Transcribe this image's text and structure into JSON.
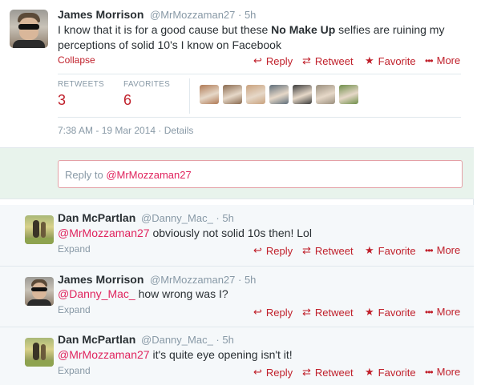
{
  "main_tweet": {
    "name": "James Morrison",
    "handle": "@MrMozzaman27 · 5h",
    "text_before": "I know that it is for a good cause but these ",
    "text_bold": "No Make Up",
    "text_after": " selfies are ruining my perceptions of solid 10's I know on Facebook",
    "collapse_label": "Collapse",
    "actions": {
      "reply": "Reply",
      "retweet": "Retweet",
      "favorite": "Favorite",
      "more": "More"
    },
    "stats": {
      "retweets_label": "RETWEETS",
      "retweets_value": "3",
      "favorites_label": "FAVORITES",
      "favorites_value": "6"
    },
    "favoriter_avatar_colors": [
      "#b07a55",
      "#8a6a4f",
      "#c9a27e",
      "#5f6e7a",
      "#3c3c3c",
      "#9a8f7e",
      "#6f8f4a"
    ],
    "timestamp": "7:38 AM - 19 Mar 2014 · Details"
  },
  "reply_box": {
    "prefix": "Reply to ",
    "mention": "@MrMozzaman27"
  },
  "replies": [
    {
      "name": "Dan McPartlan",
      "handle": "@Danny_Mac_ · 5h",
      "mention": "@MrMozzaman27",
      "text": " obviously not solid 10s then! Lol",
      "expand_label": "Expand",
      "actions": {
        "reply": "Reply",
        "retweet": "Retweet",
        "favorite": "Favorite",
        "more": "More"
      }
    },
    {
      "name": "James Morrison",
      "handle": "@MrMozzaman27 · 5h",
      "mention": "@Danny_Mac_",
      "text": " how wrong was I?",
      "expand_label": "Expand",
      "actions": {
        "reply": "Reply",
        "retweet": "Retweet",
        "favorite": "Favorite",
        "more": "More"
      }
    },
    {
      "name": "Dan McPartlan",
      "handle": "@Danny_Mac_ · 5h",
      "mention": "@MrMozzaman27",
      "text": " it's quite eye opening isn't it!",
      "expand_label": "Expand",
      "actions": {
        "reply": "Reply",
        "retweet": "Retweet",
        "favorite": "Favorite",
        "more": "More"
      }
    }
  ],
  "icons": {
    "reply": "reply-arrow-icon",
    "retweet": "retweet-icon",
    "favorite": "star-icon",
    "more": "ellipsis-icon"
  },
  "colors": {
    "accent": "#c0202b",
    "mention": "#e0245e",
    "muted": "#8899a6",
    "reply_area_bg": "#e8f3ec"
  }
}
